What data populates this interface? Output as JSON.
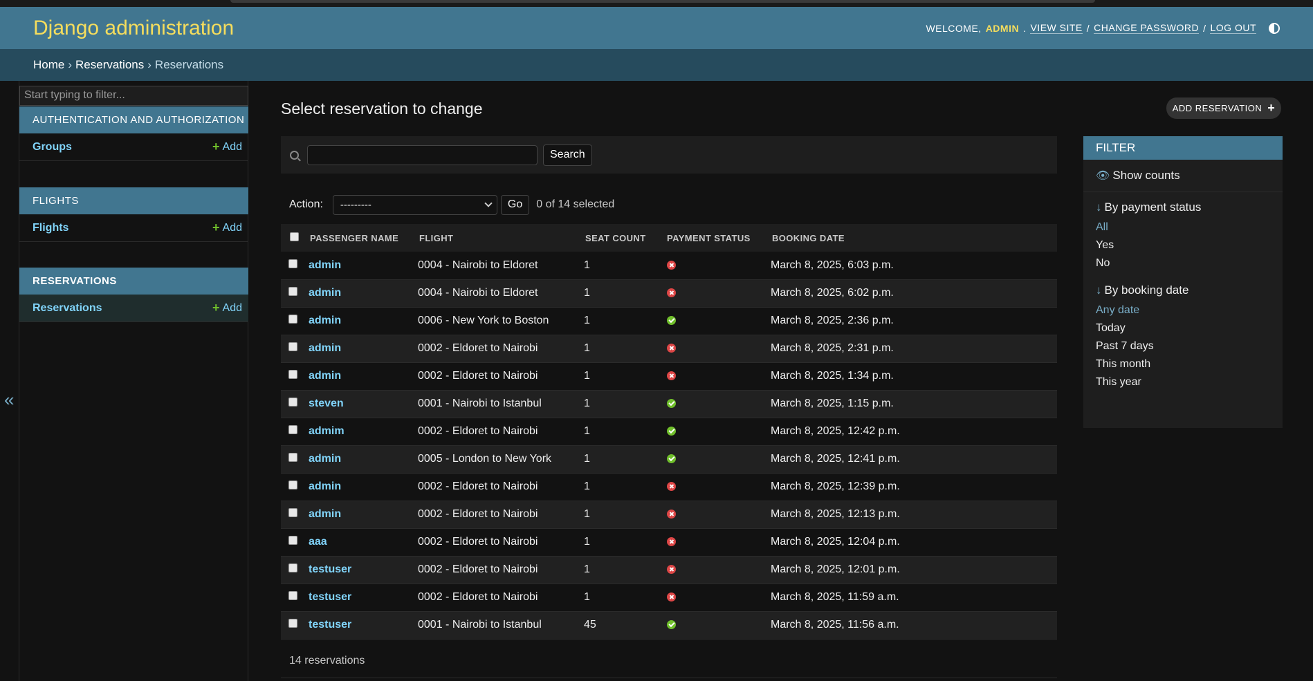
{
  "header": {
    "brand": "Django administration",
    "welcome": "Welcome,",
    "user": "admin",
    "view_site": "View site",
    "change_password": "Change password",
    "log_out": "Log out"
  },
  "breadcrumbs": [
    "Home",
    "Reservations",
    "Reservations"
  ],
  "sidebar": {
    "filter_placeholder": "Start typing to filter...",
    "collapse_glyph": "«",
    "modules": [
      {
        "caption": "Authentication and Authorization",
        "model": "Groups",
        "add": "Add"
      },
      {
        "caption": "Flights",
        "model": "Flights",
        "add": "Add"
      },
      {
        "caption": "Reservations",
        "model": "Reservations",
        "add": "Add"
      }
    ]
  },
  "main": {
    "title": "Select reservation to change",
    "add_button": "Add reservation",
    "search_button": "Search",
    "action_label": "Action:",
    "action_value": "---------",
    "go_button": "Go",
    "selected_count": "0 of 14 selected",
    "columns": [
      "Passenger name",
      "Flight",
      "Seat count",
      "Payment status",
      "Booking date"
    ],
    "rows": [
      {
        "passenger": "admin",
        "flight": "0004 - Nairobi to Eldoret",
        "seats": "1",
        "paid": false,
        "date": "March 8, 2025, 6:03 p.m."
      },
      {
        "passenger": "admin",
        "flight": "0004 - Nairobi to Eldoret",
        "seats": "1",
        "paid": false,
        "date": "March 8, 2025, 6:02 p.m."
      },
      {
        "passenger": "admin",
        "flight": "0006 - New York to Boston",
        "seats": "1",
        "paid": true,
        "date": "March 8, 2025, 2:36 p.m."
      },
      {
        "passenger": "admin",
        "flight": "0002 - Eldoret to Nairobi",
        "seats": "1",
        "paid": false,
        "date": "March 8, 2025, 2:31 p.m."
      },
      {
        "passenger": "admin",
        "flight": "0002 - Eldoret to Nairobi",
        "seats": "1",
        "paid": false,
        "date": "March 8, 2025, 1:34 p.m."
      },
      {
        "passenger": "steven",
        "flight": "0001 - Nairobi to Istanbul",
        "seats": "1",
        "paid": true,
        "date": "March 8, 2025, 1:15 p.m."
      },
      {
        "passenger": "admim",
        "flight": "0002 - Eldoret to Nairobi",
        "seats": "1",
        "paid": true,
        "date": "March 8, 2025, 12:42 p.m."
      },
      {
        "passenger": "admin",
        "flight": "0005 - London to New York",
        "seats": "1",
        "paid": true,
        "date": "March 8, 2025, 12:41 p.m."
      },
      {
        "passenger": "admin",
        "flight": "0002 - Eldoret to Nairobi",
        "seats": "1",
        "paid": false,
        "date": "March 8, 2025, 12:39 p.m."
      },
      {
        "passenger": "admin",
        "flight": "0002 - Eldoret to Nairobi",
        "seats": "1",
        "paid": false,
        "date": "March 8, 2025, 12:13 p.m."
      },
      {
        "passenger": "aaa",
        "flight": "0002 - Eldoret to Nairobi",
        "seats": "1",
        "paid": false,
        "date": "March 8, 2025, 12:04 p.m."
      },
      {
        "passenger": "testuser",
        "flight": "0002 - Eldoret to Nairobi",
        "seats": "1",
        "paid": false,
        "date": "March 8, 2025, 12:01 p.m."
      },
      {
        "passenger": "testuser",
        "flight": "0002 - Eldoret to Nairobi",
        "seats": "1",
        "paid": false,
        "date": "March 8, 2025, 11:59 a.m."
      },
      {
        "passenger": "testuser",
        "flight": "0001 - Nairobi to Istanbul",
        "seats": "45",
        "paid": true,
        "date": "March 8, 2025, 11:56 a.m."
      }
    ],
    "paginator": "14 reservations"
  },
  "filter": {
    "caption": "Filter",
    "show_counts": "Show counts",
    "groups": [
      {
        "title": "By payment status",
        "options": [
          "All",
          "Yes",
          "No"
        ],
        "selected": 0
      },
      {
        "title": "By booking date",
        "options": [
          "Any date",
          "Today",
          "Past 7 days",
          "This month",
          "This year"
        ],
        "selected": 0
      }
    ]
  },
  "colors": {
    "header": "#417690",
    "breadcrumbs": "#264b5d",
    "brand": "#f5dd5d",
    "link": "#81d4fa",
    "paid_yes": "#70bf2b",
    "paid_no": "#dd4646"
  },
  "icons": [
    "theme-toggle-icon",
    "collapse-sidebar-icon",
    "add-plus-icon",
    "search-icon",
    "chevron-down-icon",
    "eye-icon",
    "sort-arrow-icon",
    "status-yes-icon",
    "status-no-icon"
  ]
}
